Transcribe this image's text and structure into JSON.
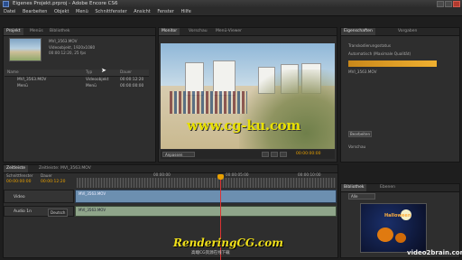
{
  "window": {
    "title": "Eigenes Projekt.prproj - Adobe Encore CS6"
  },
  "menu": [
    "Datei",
    "Bearbeiten",
    "Objekt",
    "Menü",
    "Schnittfenster",
    "Ansicht",
    "Fenster",
    "Hilfe"
  ],
  "project_panel": {
    "tabs": [
      "Projekt",
      "Menüs",
      "Bibliothek"
    ],
    "clip_name": "MVI_3563.MOV",
    "clip_info_1": "Videoobjekt, 1920x1080",
    "clip_info_2": "00:00:12:20, 25 fps",
    "columns": [
      "Name",
      "Typ",
      "Dauer"
    ],
    "items": [
      {
        "name": "MVI_3563.MOV",
        "type": "Videoobjekt",
        "duration": "00:00:12:20"
      },
      {
        "name": "Menü",
        "type": "Menü",
        "duration": "00:00:00:00"
      }
    ]
  },
  "monitor_panel": {
    "tabs": [
      "Monitor",
      "Vorschau",
      "Menü-Viewer"
    ],
    "watermark": "www.cg-ku.com",
    "quality": "Anpassen",
    "timecode": "00:00:00:00"
  },
  "right_panel": {
    "tabs": [
      "Eigenschaften",
      "Vorgaben"
    ],
    "section_label": "Transkodierungsstatus",
    "preset_text": "Automatisch (Maximale Qualität)",
    "clip_label": "MVI_3563.MOV",
    "edit_button": "Bearbeiten",
    "lower_label": "Vorschau"
  },
  "timeline": {
    "tabs": [
      "Zeitleiste",
      "Zeitleiste: MVI_3563.MOV"
    ],
    "label_source": "Schnittfenster",
    "label_duration": "Dauer",
    "current_time": "00:00:00:00",
    "duration": "00:00:12:20",
    "ruler_marks": [
      "00:00:00",
      "00:00:05:00",
      "00:00:10:00"
    ],
    "tracks": [
      {
        "name": "Video",
        "clip": "MVI_3563.MOV"
      },
      {
        "name": "Audio 1n",
        "clip": "MVI_3563.MOV",
        "lang": "Deutsch"
      }
    ]
  },
  "library_panel": {
    "tabs": [
      "Bibliothek",
      "Ebenen"
    ],
    "dropdown": "Alle",
    "art_title": "Halloween"
  },
  "watermarks": {
    "brand": "RenderingCG.com",
    "brand_sub": "高端CG资源在线下载",
    "corner": "video2brain.com"
  },
  "colors": {
    "accent": "#e8a000",
    "playhead": "#dd3333",
    "video_clip": "#6c8fb0",
    "audio_clip": "#8fa58a"
  }
}
